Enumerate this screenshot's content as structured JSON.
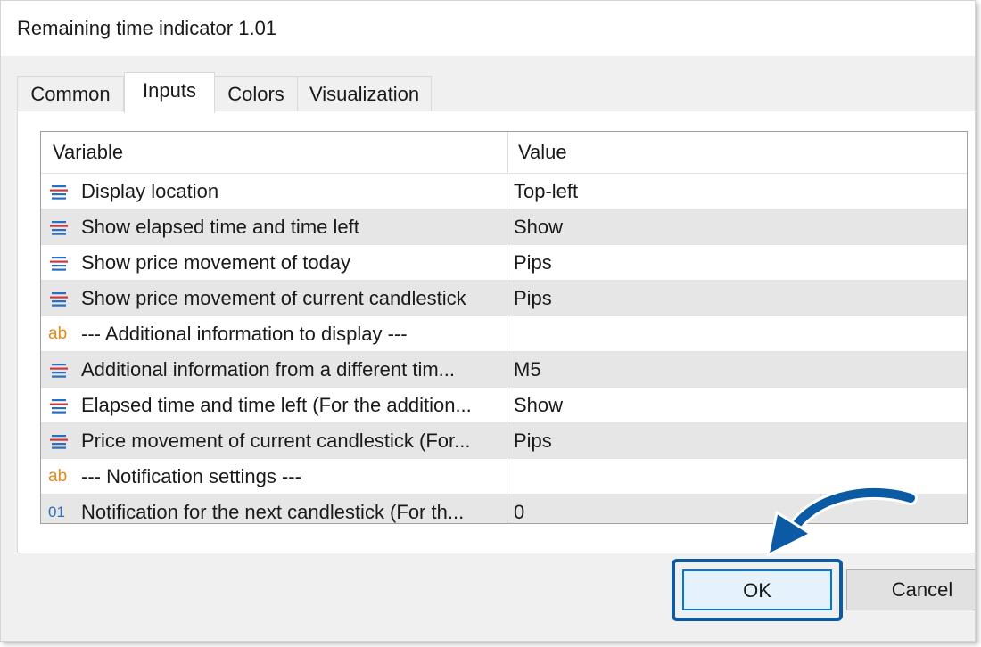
{
  "window": {
    "title": "Remaining time indicator 1.01"
  },
  "tabs": [
    {
      "label": "Common",
      "active": false
    },
    {
      "label": "Inputs",
      "active": true
    },
    {
      "label": "Colors",
      "active": false
    },
    {
      "label": "Visualization",
      "active": false
    }
  ],
  "grid": {
    "headers": {
      "variable": "Variable",
      "value": "Value"
    },
    "rows": [
      {
        "icon": "enum-icon",
        "label": "Display location",
        "value": "Top-left"
      },
      {
        "icon": "enum-icon",
        "label": "Show elapsed time and time left",
        "value": "Show"
      },
      {
        "icon": "enum-icon",
        "label": "Show price movement of today",
        "value": "Pips"
      },
      {
        "icon": "enum-icon",
        "label": "Show price movement of current candlestick",
        "value": "Pips"
      },
      {
        "icon": "string-icon",
        "icon_text": "ab",
        "label": "--- Additional information to display ---",
        "value": ""
      },
      {
        "icon": "enum-icon",
        "label": "Additional information from a different tim...",
        "value": "M5"
      },
      {
        "icon": "enum-icon",
        "label": "Elapsed time and time left (For the addition...",
        "value": "Show"
      },
      {
        "icon": "enum-icon",
        "label": "Price movement of current candlestick (For...",
        "value": "Pips"
      },
      {
        "icon": "string-icon",
        "icon_text": "ab",
        "label": "--- Notification settings ---",
        "value": ""
      },
      {
        "icon": "integer-icon",
        "icon_text": "01",
        "label": "Notification for the next candlestick (For th...",
        "value": "0"
      }
    ]
  },
  "buttons": {
    "ok": "OK",
    "cancel": "Cancel"
  },
  "colors": {
    "accent": "#0078d7",
    "highlight": "#0a5aa6",
    "string_icon": "#e08a1e",
    "enum_icon_blue": "#2a6fbf",
    "enum_icon_red": "#d0393b"
  }
}
